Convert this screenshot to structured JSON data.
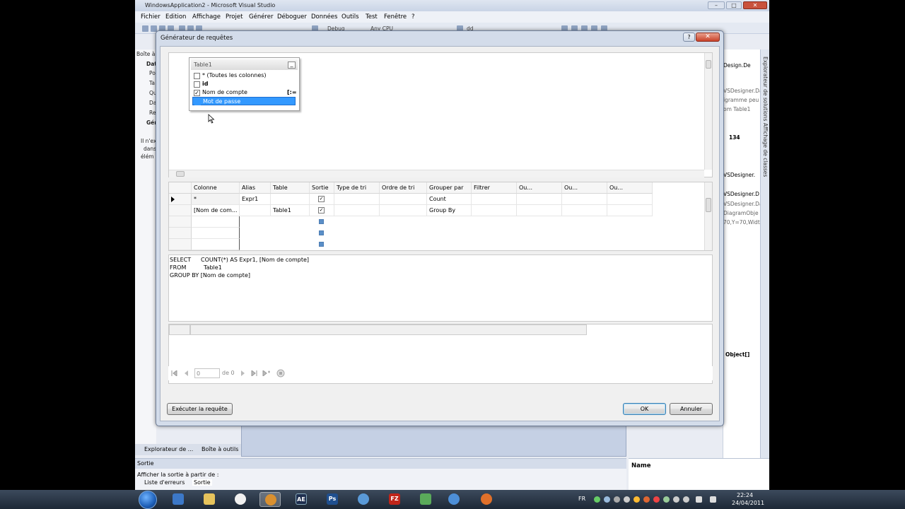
{
  "window": {
    "title": "WindowsApplication2 - Microsoft Visual Studio",
    "min": "–",
    "max": "□",
    "close": "✕"
  },
  "menu": [
    "Fichier",
    "Edition",
    "Affichage",
    "Projet",
    "Générer",
    "Déboguer",
    "Données",
    "Outils",
    "Test",
    "Fenêtre",
    "?"
  ],
  "toolbar": {
    "config": "Debug",
    "platform": "Any CPU",
    "project": "dd"
  },
  "left_panel": {
    "header": "Boîte à",
    "section1": "Dat",
    "items": [
      "Po",
      "Ta",
      "Qu",
      "Da",
      "Re"
    ],
    "section2": "Gén",
    "message_lines": [
      "Il n'ex",
      "dans",
      "élém"
    ]
  },
  "right_panel": {
    "header": "Design.De",
    "lines": [
      "VSDesigner.Da",
      "igramme peu",
      "om Table1",
      "134",
      "VSDesigner.",
      "VSDesigner.D",
      "VSDesigner.Da",
      "DiagramObje",
      "70,Y=70,Widtl",
      "Object[]"
    ],
    "strip_label": "Explorateur de solutions  Affichage de classes"
  },
  "bottom_tabs": {
    "explorer": "Explorateur de ...",
    "toolbox": "Boîte à outils"
  },
  "output": {
    "title": "Sortie",
    "show_from": "Afficher la sortie à partir de :",
    "tabs": [
      "Liste d'erreurs",
      "Sortie"
    ]
  },
  "properties": {
    "name_header": "Name"
  },
  "dialog": {
    "title": "Générateur de requêtes",
    "help": "?",
    "close": "✕",
    "table": {
      "name": "Table1",
      "min": "_",
      "columns": [
        {
          "label": "* (Toutes les colonnes)",
          "checked": false,
          "bold": false
        },
        {
          "label": "id",
          "checked": false,
          "bold": true
        },
        {
          "label": "Nom de compte",
          "checked": true,
          "bold": false,
          "group_icon": "[:="
        },
        {
          "label": "Mot de passe",
          "checked": false,
          "bold": false,
          "selected": true
        }
      ]
    },
    "grid": {
      "headers": [
        "Colonne",
        "Alias",
        "Table",
        "Sortie",
        "Type de tri",
        "Ordre de tri",
        "Grouper par",
        "Filtrer",
        "Ou...",
        "Ou...",
        "Ou..."
      ],
      "rows": [
        {
          "colonne": "*",
          "alias": "Expr1",
          "table": "",
          "grouper": "Count"
        },
        {
          "colonne": "[Nom de com...",
          "alias": "",
          "table": "Table1",
          "grouper": "Group By"
        }
      ],
      "check_mark": "✓"
    },
    "sql": {
      "kw_select": "SELECT",
      "select_clause": "COUNT(*) AS Expr1, [Nom de compte]",
      "kw_from": "FROM",
      "from_clause": "Table1",
      "group_line": "GROUP BY [Nom de compte]"
    },
    "nav": {
      "page_input": "0",
      "of_label": "de 0"
    },
    "buttons": {
      "execute": "Exécuter la requête",
      "ok": "OK",
      "cancel": "Annuler"
    }
  },
  "taskbar": {
    "lang": "FR",
    "time": "22:24",
    "date": "24/04/2011",
    "apps": [
      "folder",
      "explorer",
      "media",
      "vs",
      "ae",
      "ps",
      "network",
      "filezilla",
      "puzzle",
      "safari",
      "paw"
    ]
  }
}
